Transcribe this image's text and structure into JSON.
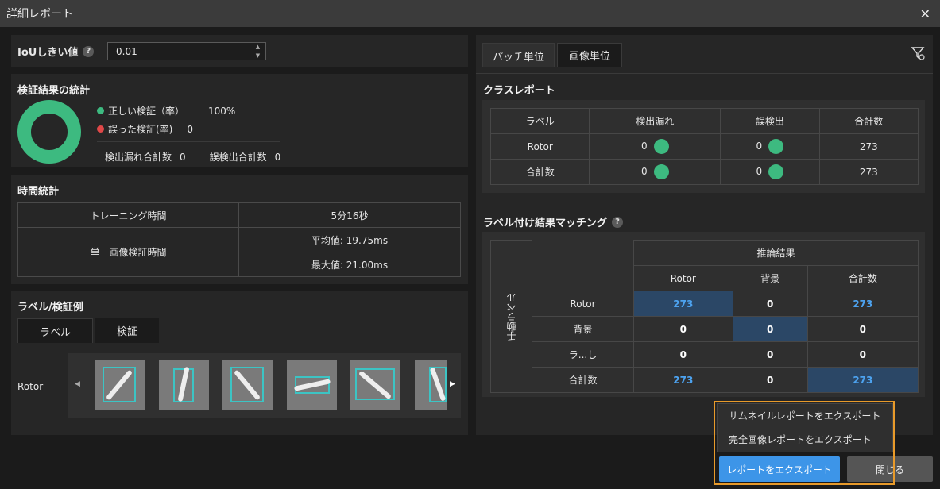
{
  "window": {
    "title": "詳細レポート"
  },
  "iou": {
    "label": "IoUしきい値",
    "value": "0.01",
    "help": "?"
  },
  "stats": {
    "title": "検証結果の統計",
    "correct_label": "正しい検証（率）",
    "correct_value": "100%",
    "wrong_label": "誤った検証(率)",
    "wrong_value": "0",
    "missed_label": "検出漏れ合計数",
    "missed_value": "0",
    "false_label": "誤検出合計数",
    "false_value": "0",
    "colors": {
      "correct": "#3dba80",
      "wrong": "#e04848"
    }
  },
  "time": {
    "title": "時間統計",
    "training_label": "トレーニング時間",
    "training_value": "5分16秒",
    "single_label": "単一画像検証時間",
    "avg": "平均値: 19.75ms",
    "max": "最大値: 21.00ms"
  },
  "examples": {
    "title": "ラベル/検証例",
    "tabs": [
      "ラベル",
      "検証"
    ],
    "row_label": "Rotor"
  },
  "right": {
    "tabs": [
      "パッチ単位",
      "画像単位"
    ]
  },
  "class_report": {
    "title": "クラスレポート",
    "headers": [
      "ラベル",
      "検出漏れ",
      "誤検出",
      "合計数"
    ],
    "rows": [
      {
        "label": "Rotor",
        "missed": "0",
        "false": "0",
        "total": "273"
      },
      {
        "label": "合計数",
        "missed": "0",
        "false": "0",
        "total": "273"
      }
    ]
  },
  "matching": {
    "title": "ラベル付け結果マッチング",
    "help": "?",
    "pred_header": "推論結果",
    "side_label": "手動ラベル",
    "cols": [
      "Rotor",
      "背景",
      "合計数"
    ],
    "rows": [
      {
        "label": "Rotor",
        "v": [
          "273",
          "0",
          "273"
        ]
      },
      {
        "label": "背景",
        "v": [
          "0",
          "0",
          "0"
        ]
      },
      {
        "label": "ラ...し",
        "v": [
          "0",
          "0",
          "0"
        ]
      },
      {
        "label": "合計数",
        "v": [
          "273",
          "0",
          "273"
        ]
      }
    ]
  },
  "export_menu": {
    "items": [
      "サムネイルレポートをエクスポート",
      "完全画像レポートをエクスポート"
    ]
  },
  "buttons": {
    "export": "レポートをエクスポート",
    "close": "閉じる"
  }
}
